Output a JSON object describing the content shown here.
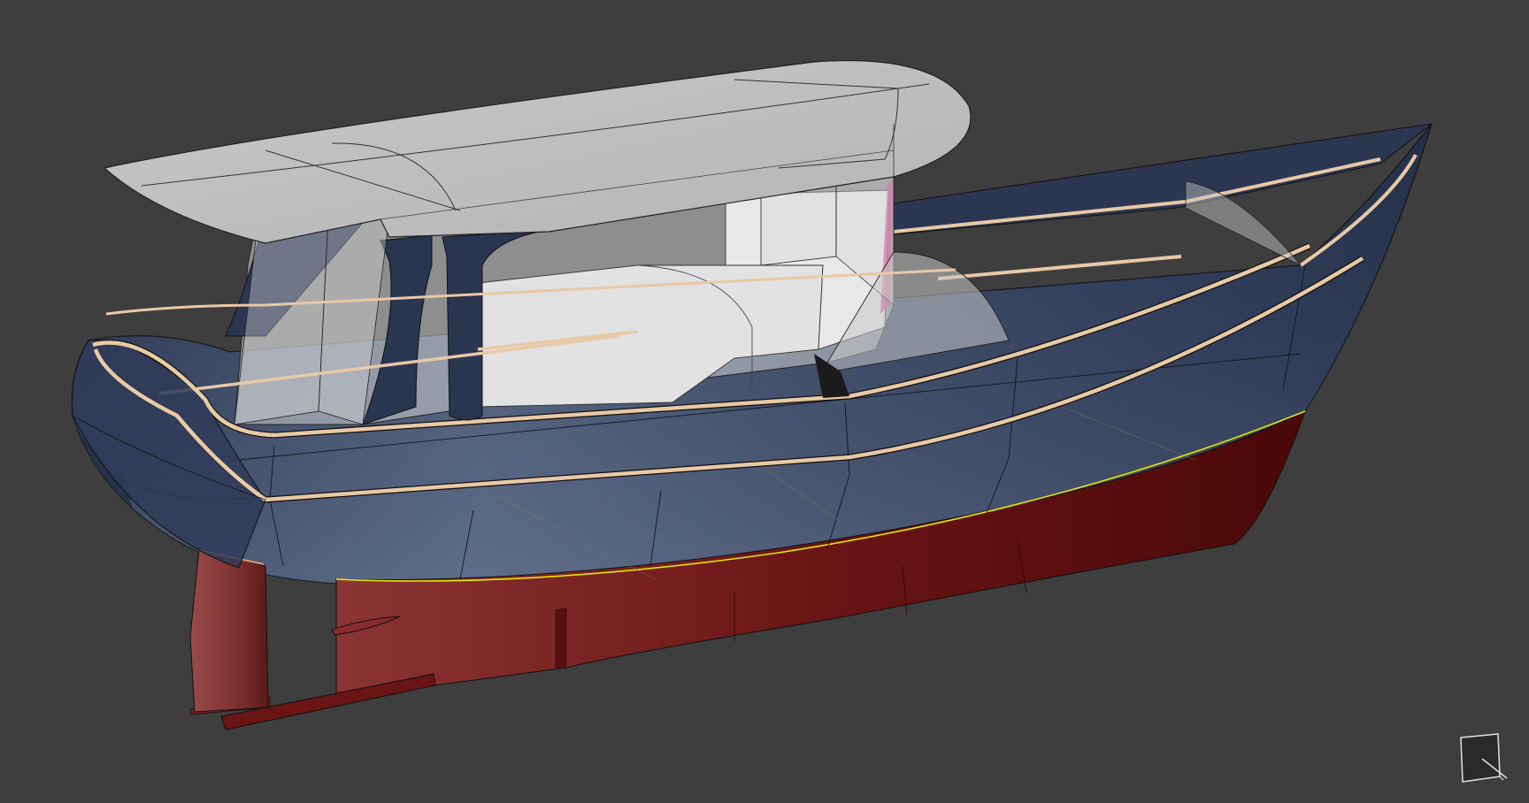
{
  "viewport": {
    "background_color": "#3e3e3e",
    "model": "boat-hull-3d-render",
    "colors": {
      "hull_topside": "#3a4a6a",
      "hull_bottom": "#7a1c1c",
      "rub_rail": "#e8c9a6",
      "waterline": "#e6e600",
      "glass": "#d0d0d0"
    }
  },
  "nav_cube": {
    "icon": "view-orientation-cube-icon"
  }
}
